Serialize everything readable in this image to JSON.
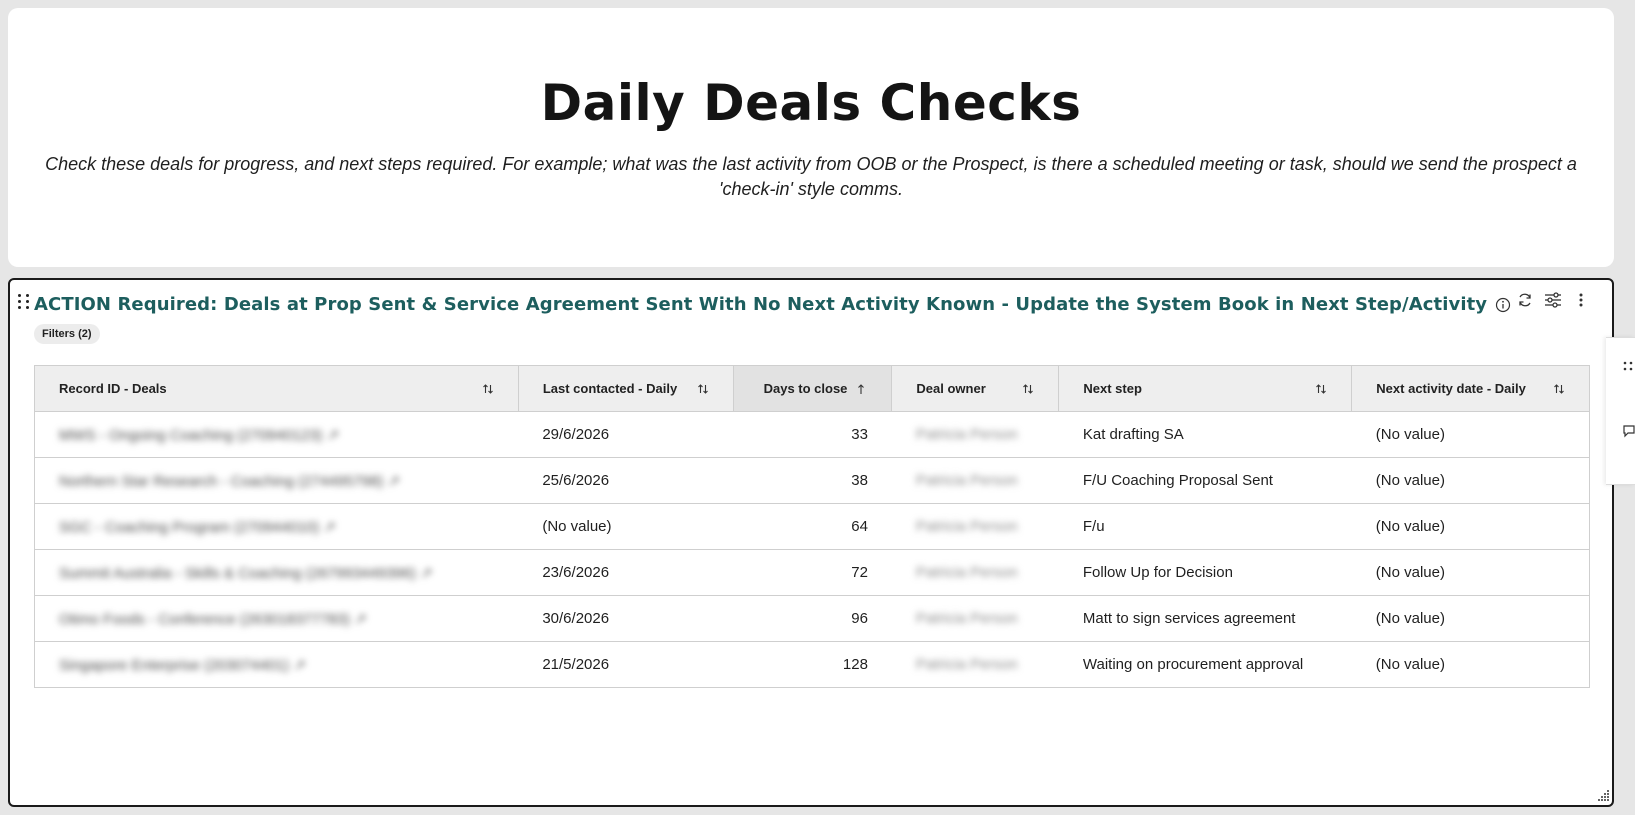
{
  "header": {
    "title": "Daily Deals Checks",
    "description": "Check these deals for progress, and next steps required. For example; what was the last activity from OOB or the Prospect, is there a scheduled meeting or task, should we send the prospect a 'check-in' style comms."
  },
  "report": {
    "title": "ACTION Required: Deals at Prop Sent & Service Agreement Sent With No Next Activity Known - Update the System Book in Next Step/Activity",
    "filters_label": "Filters (2)",
    "icons": {
      "info": "info-icon",
      "refresh": "refresh-icon",
      "settings": "sliders-icon",
      "more": "more-vertical-icon",
      "drag": "drag-handle-icon",
      "resize": "resize-grip-icon"
    },
    "columns": [
      {
        "label": "Record ID - Deals"
      },
      {
        "label": "Last contacted - Daily"
      },
      {
        "label": "Days to close"
      },
      {
        "label": "Deal owner"
      },
      {
        "label": "Next step"
      },
      {
        "label": "Next activity date - Daily"
      }
    ],
    "rows": [
      {
        "record": "MWS - Ongoing Coaching (270940123) ↗",
        "last_contacted": "29/6/2026",
        "days": "33",
        "owner": "Patricia Person",
        "next_step": "Kat drafting SA",
        "next_activity": "(No value)"
      },
      {
        "record": "Northern Star Research - Coaching (274495798) ↗",
        "last_contacted": "25/6/2026",
        "days": "38",
        "owner": "Patricia Person",
        "next_step": "F/U Coaching Proposal Sent",
        "next_activity": "(No value)"
      },
      {
        "record": "SGC - Coaching Program (270944010) ↗",
        "last_contacted": "(No value)",
        "days": "64",
        "owner": "Patricia Person",
        "next_step": "F/u",
        "next_activity": "(No value)"
      },
      {
        "record": "Summit Australia - Skills & Coaching (267993449396) ↗",
        "last_contacted": "23/6/2026",
        "days": "72",
        "owner": "Patricia Person",
        "next_step": "Follow Up for Decision",
        "next_activity": "(No value)"
      },
      {
        "record": "Otimo Foods - Conference (263018377783) ↗",
        "last_contacted": "30/6/2026",
        "days": "96",
        "owner": "Patricia Person",
        "next_step": "Matt to sign services agreement",
        "next_activity": "(No value)"
      },
      {
        "record": "Singapore Enterprise (203074401) ↗",
        "last_contacted": "21/5/2026",
        "days": "128",
        "owner": "Patricia Person",
        "next_step": "Waiting on procurement approval",
        "next_activity": "(No value)"
      }
    ]
  },
  "colors": {
    "title_teal": "#1d5e5e",
    "header_bg": "#eeeeee",
    "border": "#cfcfcf"
  }
}
